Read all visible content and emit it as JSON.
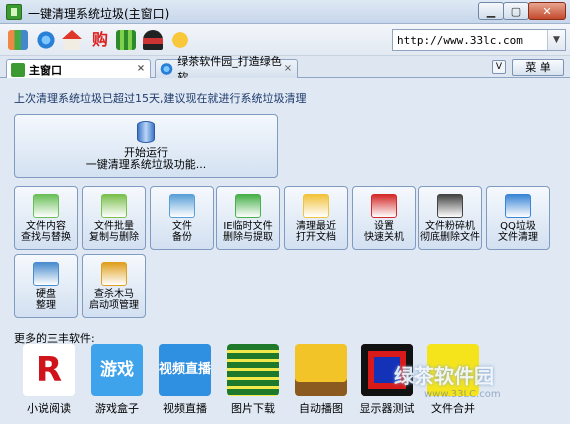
{
  "window": {
    "title": "一键清理系统垃圾(主窗口)"
  },
  "toolbar": {
    "url": "http://www.33lc.com",
    "icons": [
      "grid-icon",
      "ie-browser-icon",
      "home-icon",
      "shopping-icon",
      "game-icon",
      "dance-icon",
      "chat-bubble-icon"
    ]
  },
  "tabs": [
    {
      "label": "主窗口"
    },
    {
      "label": "绿茶软件园_打造绿色软..."
    }
  ],
  "menu_label": "菜 单",
  "chevron_label": "V",
  "notice": "上次清理系统垃圾已超过15天,建议现在就进行系统垃圾清理",
  "primary": {
    "line1": "开始运行",
    "line2": "一键清理系统垃圾功能..."
  },
  "tools": [
    {
      "line1": "文件内容",
      "line2": "查找与替换",
      "icon": "document-search-icon",
      "color": "#6bbf5a"
    },
    {
      "line1": "文件批量",
      "line2": "复制与删除",
      "icon": "document-copy-icon",
      "color": "#7cc04d"
    },
    {
      "line1": "文件",
      "line2": "备份",
      "icon": "backup-icon",
      "color": "#5aa0d8"
    },
    {
      "line1": "IE临时文件",
      "line2": "删除与提取",
      "icon": "recycle-icon",
      "color": "#48b04a"
    },
    {
      "line1": "清理最近",
      "line2": "打开文档",
      "icon": "folder-icon",
      "color": "#f2c33c"
    },
    {
      "line1": "设置",
      "line2": "快速关机",
      "icon": "power-icon",
      "color": "#d42a2a"
    },
    {
      "line1": "文件粉碎机",
      "line2": "彻底删除文件",
      "icon": "shredder-icon",
      "color": "#444444"
    },
    {
      "line1": "QQ垃圾",
      "line2": "文件清理",
      "icon": "qq-icon",
      "color": "#3a86d6"
    },
    {
      "line1": "硬盘",
      "line2": "整理",
      "icon": "harddisk-icon",
      "color": "#4a8ccf"
    },
    {
      "line1": "查杀木马",
      "line2": "启动项管理",
      "icon": "shield-icon",
      "color": "#e0a020"
    }
  ],
  "more_label": "更多的三丰软件:",
  "software": [
    {
      "label": "小说阅读",
      "icon": "novel-reader-icon",
      "glyph": "R",
      "bg": "#ffffff",
      "fg": "#d0141c"
    },
    {
      "label": "游戏盒子",
      "icon": "game-box-icon",
      "glyph": "游戏",
      "bg": "#3ea3ea",
      "fg": "#ffffff"
    },
    {
      "label": "视频直播",
      "icon": "video-live-icon",
      "glyph": "视频直播",
      "bg": "#2f8fe0",
      "fg": "#ffffff"
    },
    {
      "label": "图片下载",
      "icon": "image-download-icon",
      "glyph": "",
      "bg": "#1e7a2a",
      "fg": "#ffffff"
    },
    {
      "label": "自动播图",
      "icon": "slideshow-icon",
      "glyph": "",
      "bg": "#f2c428",
      "fg": "#3a8ad8"
    },
    {
      "label": "显示器测试",
      "icon": "monitor-test-icon",
      "glyph": "",
      "bg": "#d81a1a",
      "fg": "#1432b8"
    },
    {
      "label": "文件合并",
      "icon": "file-merge-icon",
      "glyph": "",
      "bg": "#f5e41c",
      "fg": "#222222"
    }
  ],
  "watermark": {
    "line1": "绿茶软件园",
    "line2": "www.33LC.com"
  }
}
